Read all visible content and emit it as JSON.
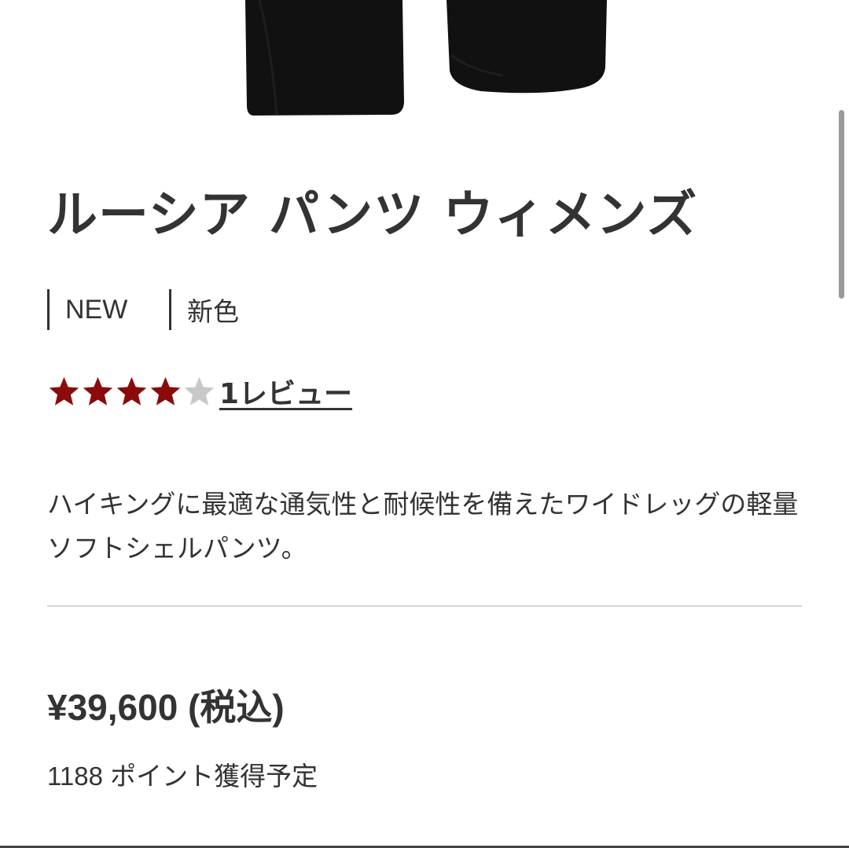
{
  "product": {
    "image_alt": "product-photo",
    "title": "ルーシア パンツ ウィメンズ",
    "tags": [
      "NEW",
      "新色"
    ],
    "rating": {
      "value": 4,
      "max": 5,
      "filled_color": "#8b0b0b",
      "empty_color": "#c8c8c8",
      "review_label": "1レビュー"
    },
    "description": "ハイキングに最適な通気性と耐候性を備えたワイドレッグの軽量ソフトシェルパンツ。",
    "price": "¥39,600 (税込)",
    "points": "1188 ポイント獲得予定"
  }
}
